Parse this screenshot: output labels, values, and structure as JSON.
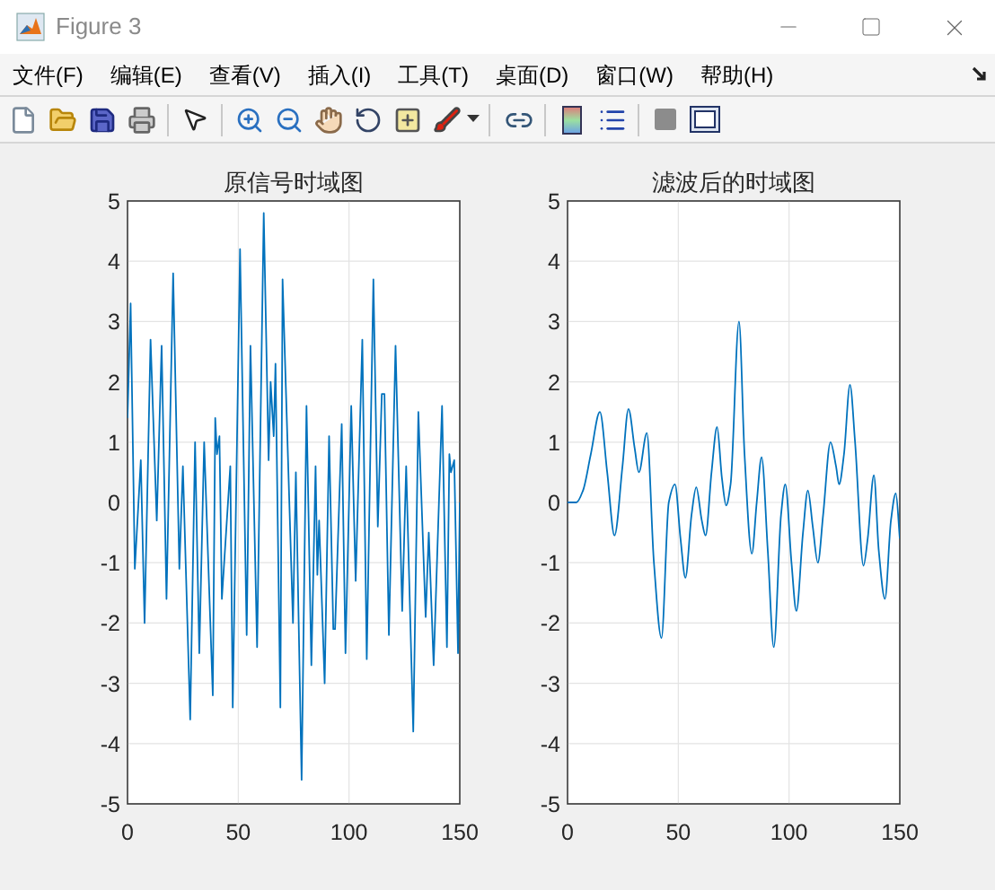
{
  "window": {
    "title": "Figure 3"
  },
  "menu": [
    {
      "label": "文件(F)"
    },
    {
      "label": "编辑(E)"
    },
    {
      "label": "查看(V)"
    },
    {
      "label": "插入(I)"
    },
    {
      "label": "工具(T)"
    },
    {
      "label": "桌面(D)"
    },
    {
      "label": "窗口(W)"
    },
    {
      "label": "帮助(H)"
    }
  ],
  "axes": [
    {
      "chart_data": {
        "type": "line",
        "grid": true,
        "title": "原信号时域图",
        "xlim": [
          0,
          150
        ],
        "ylim": [
          -5,
          5
        ],
        "xticks": [
          0,
          50,
          100,
          150
        ],
        "yticks": [
          -5,
          -4,
          -3,
          -2,
          -1,
          0,
          1,
          2,
          3,
          4,
          5
        ],
        "x": [
          0,
          1.4,
          3.3,
          6,
          7.7,
          10.4,
          13.2,
          15.4,
          17.6,
          20.6,
          23.4,
          25,
          28.3,
          30.5,
          32.4,
          34.6,
          38.5,
          39.6,
          40.4,
          41.5,
          42.6,
          46.4,
          47.5,
          50.8,
          53.8,
          55.5,
          58.5,
          61.5,
          63.7,
          64.6,
          66,
          66.8,
          69,
          70,
          74.7,
          76,
          78.6,
          80.8,
          83,
          84.9,
          85.7,
          86.5,
          89,
          91,
          92.9,
          93.7,
          96.7,
          98.4,
          101,
          103,
          106,
          108,
          111,
          113,
          114.8,
          116,
          118,
          121,
          124,
          125.8,
          129,
          131.3,
          134.6,
          136,
          138.2,
          142,
          144.2,
          145.3,
          146,
          147.5,
          149.2,
          150
        ],
        "series": [
          {
            "color": "#0072bd",
            "values": [
              1.4,
              3.3,
              -1.1,
              0.7,
              -2,
              2.7,
              -0.3,
              2.6,
              -1.6,
              3.8,
              -1.1,
              0.6,
              -3.6,
              1,
              -2.5,
              1,
              -3.2,
              1.4,
              0.8,
              1.1,
              -1.6,
              0.6,
              -3.4,
              4.2,
              -2.2,
              2.6,
              -2.4,
              4.8,
              0.7,
              2,
              1.1,
              2.3,
              -3.4,
              3.7,
              -2,
              0.5,
              -4.6,
              1.6,
              -2.7,
              0.6,
              -1.2,
              -0.3,
              -3,
              1.1,
              -2.1,
              -2.1,
              1.3,
              -2.5,
              1.6,
              -1.3,
              2.7,
              -2.6,
              3.7,
              -0.4,
              1.8,
              1.8,
              -2.2,
              2.6,
              -1.8,
              0.6,
              -3.8,
              1.5,
              -1.9,
              -0.5,
              -2.7,
              1.6,
              -2.4,
              0.8,
              0.5,
              0.7,
              -2.5,
              0
            ]
          }
        ]
      }
    },
    {
      "chart_data": {
        "type": "line",
        "grid": true,
        "title": "滤波后的时域图",
        "xlim": [
          0,
          150
        ],
        "ylim": [
          -5,
          5
        ],
        "xticks": [
          0,
          50,
          100,
          150
        ],
        "yticks": [
          -5,
          -4,
          -3,
          -2,
          -1,
          0,
          1,
          2,
          3,
          4,
          5
        ],
        "x": [
          0,
          4,
          7,
          10.5,
          14.6,
          17.9,
          21.2,
          24.8,
          27.5,
          30.3,
          32.2,
          35.8,
          39,
          42.4,
          45.7,
          48.5,
          51,
          53.2,
          56,
          58.1,
          60.6,
          62.3,
          65,
          67.5,
          69.7,
          71.6,
          73.6,
          77.4,
          79.9,
          83.2,
          85.4,
          87.6,
          90.4,
          93.1,
          96.4,
          98.3,
          101.1,
          103.3,
          106.3,
          108.5,
          110.7,
          113,
          115.4,
          118.7,
          121.2,
          122.6,
          124.8,
          127.5,
          129.8,
          133.6,
          135.5,
          138.3,
          140.5,
          143.3,
          146,
          148.2,
          150
        ],
        "series": [
          {
            "color": "#0072bd",
            "values": [
              0,
              0,
              0.2,
              0.8,
              1.5,
              0.5,
              -0.55,
              0.6,
              1.55,
              0.9,
              0.5,
              1.15,
              -1,
              -2.25,
              0,
              0.3,
              -0.6,
              -1.25,
              -0.2,
              0.25,
              -0.3,
              -0.55,
              0.5,
              1.25,
              0.4,
              -0.05,
              0.3,
              3,
              0.8,
              -0.85,
              0,
              0.75,
              -0.8,
              -2.4,
              -0.2,
              0.3,
              -1,
              -1.8,
              -0.5,
              0.2,
              -0.4,
              -1,
              -0.2,
              1,
              0.6,
              0.3,
              0.8,
              1.95,
              1,
              -1.05,
              -0.6,
              0.45,
              -0.8,
              -1.6,
              -0.3,
              0.15,
              -0.6
            ]
          }
        ]
      }
    }
  ]
}
